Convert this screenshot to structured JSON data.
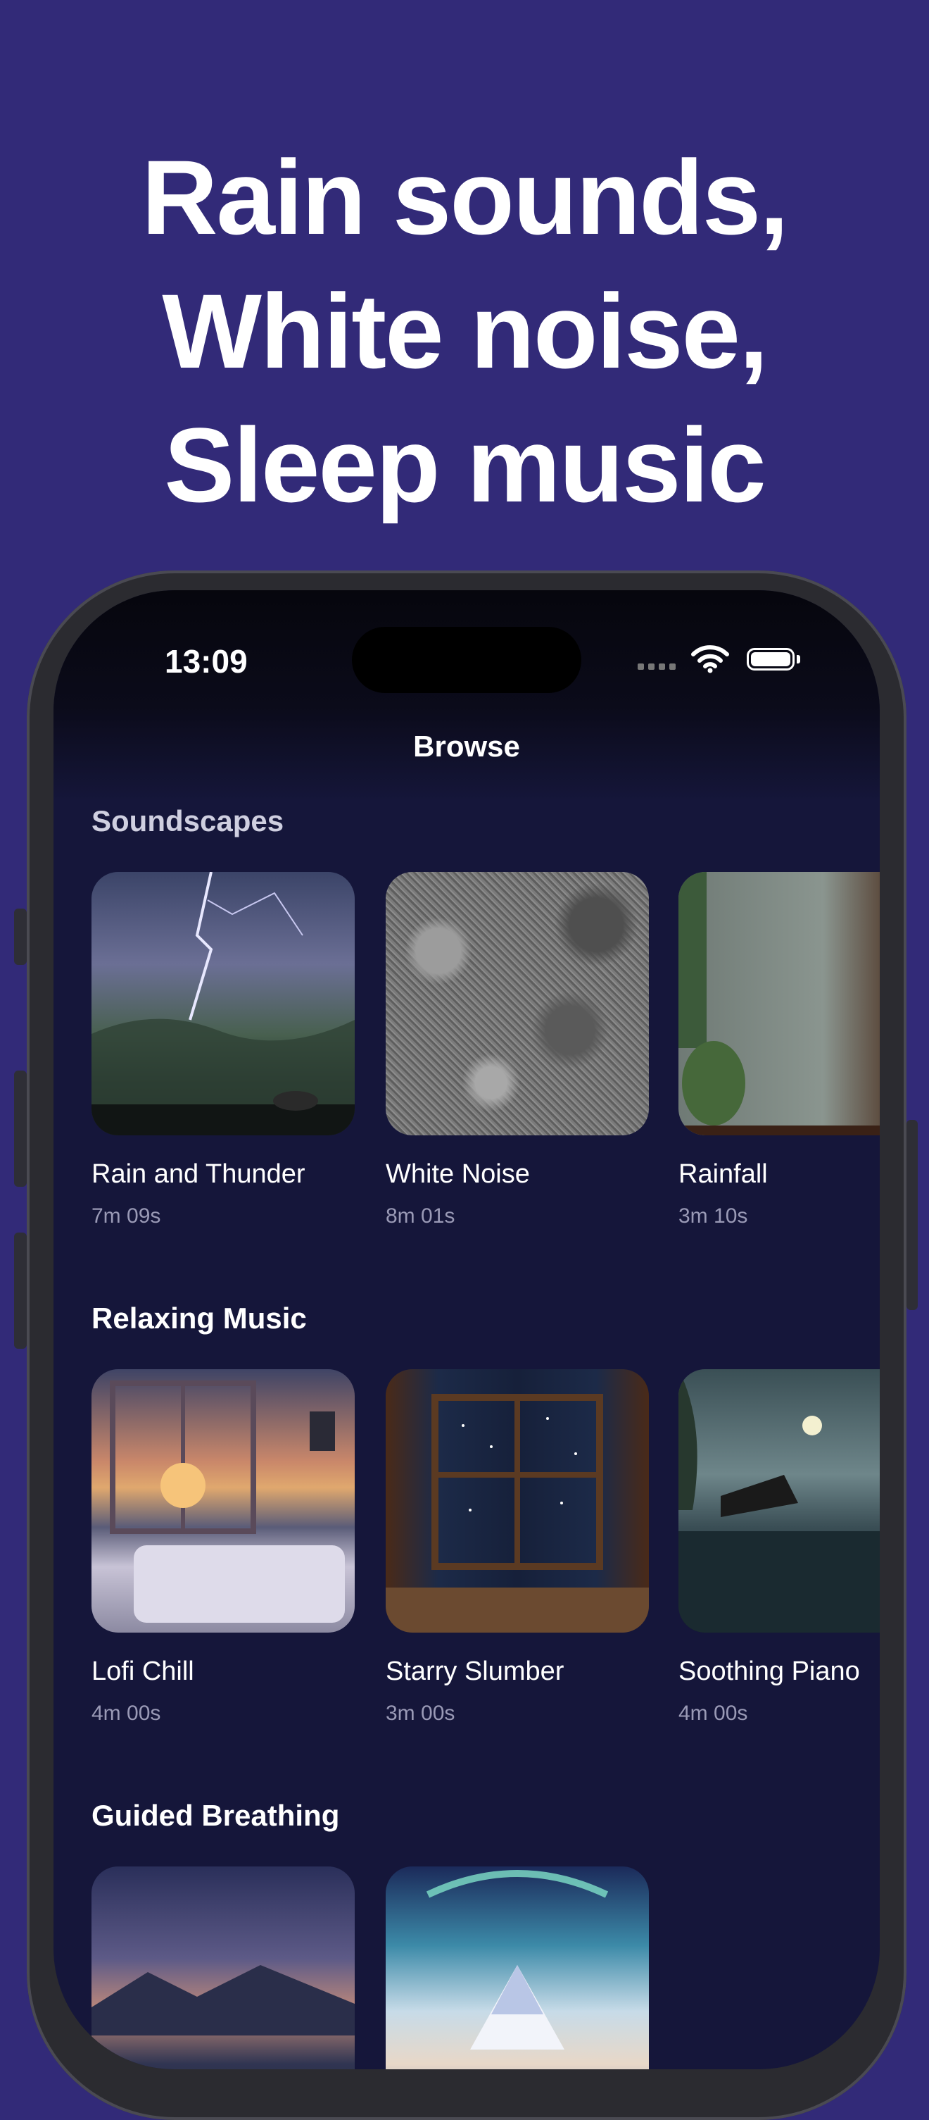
{
  "headline": {
    "line1": "Rain sounds,",
    "line2": "White noise,",
    "line3": "Sleep music"
  },
  "status_bar": {
    "time": "13:09",
    "wifi_icon": "wifi-icon",
    "battery_icon": "battery-icon"
  },
  "nav": {
    "title": "Browse"
  },
  "sections": [
    {
      "title": "Soundscapes",
      "items": [
        {
          "title": "Rain and Thunder",
          "duration": "7m 09s"
        },
        {
          "title": "White Noise",
          "duration": "8m 01s"
        },
        {
          "title": "Rainfall",
          "duration": "3m 10s"
        }
      ]
    },
    {
      "title": "Relaxing Music",
      "items": [
        {
          "title": "Lofi Chill",
          "duration": "4m 00s"
        },
        {
          "title": "Starry Slumber",
          "duration": "3m 00s"
        },
        {
          "title": "Soothing Piano",
          "duration": "4m 00s"
        }
      ]
    },
    {
      "title": "Guided Breathing",
      "items": [
        {
          "title": "",
          "duration": ""
        },
        {
          "title": "",
          "duration": ""
        }
      ]
    }
  ],
  "colors": {
    "background": "#322a78",
    "screen": "#15163a",
    "text": "#ffffff",
    "secondary_text": "#9a9ab6"
  }
}
